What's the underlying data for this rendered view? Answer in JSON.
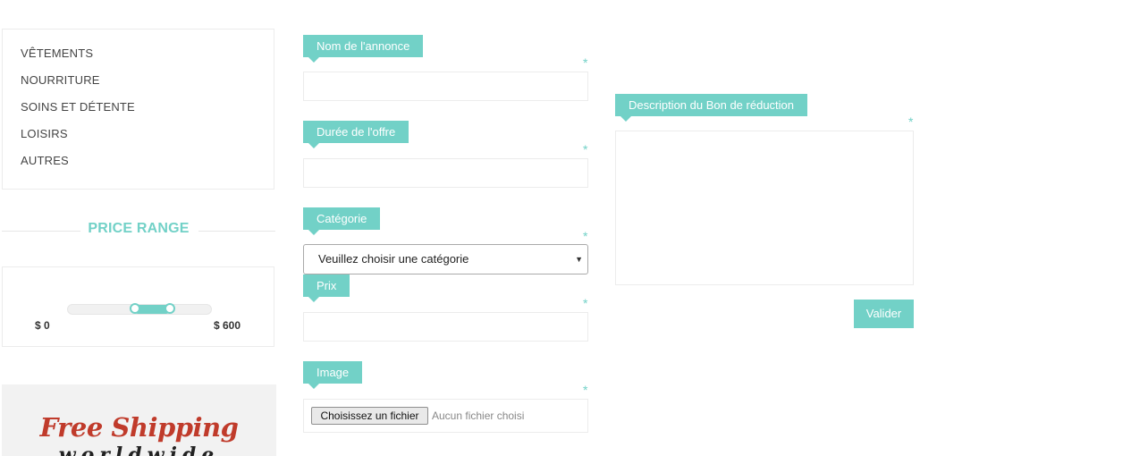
{
  "sidebar": {
    "categories": [
      "VÊTEMENTS",
      "NOURRITURE",
      "SOINS ET DÉTENTE",
      "LOISIRS",
      "AUTRES"
    ],
    "price_range": {
      "title": "PRICE RANGE",
      "min_label": "$ 0",
      "max_label": "$ 600"
    },
    "banner": {
      "title": "Free Shipping",
      "subtitle": "worldwide"
    }
  },
  "form": {
    "required_mark": "*",
    "nom": {
      "label": "Nom de l'annonce",
      "value": ""
    },
    "duree": {
      "label": "Durée de l'offre",
      "value": ""
    },
    "categorie": {
      "label": "Catégorie",
      "selected": "Veuillez choisir une catégorie"
    },
    "prix": {
      "label": "Prix",
      "value": ""
    },
    "image": {
      "label": "Image",
      "button": "Choisissez un fichier",
      "status": "Aucun fichier choisi"
    },
    "description": {
      "label": "Description du Bon de réduction",
      "value": ""
    },
    "submit": "Valider"
  },
  "colors": {
    "accent": "#72d1c7",
    "banner_red": "#c03b2b"
  }
}
